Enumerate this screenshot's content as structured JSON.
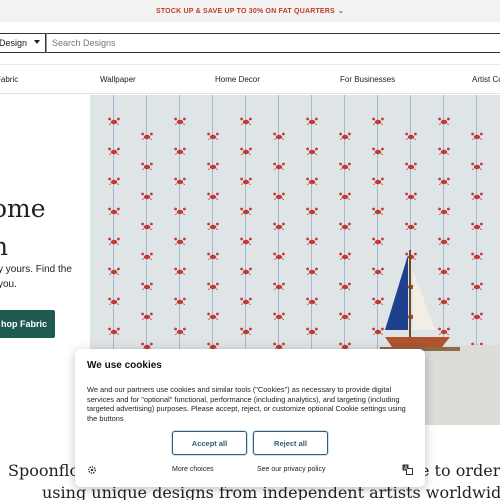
{
  "promo": {
    "text": "STOCK UP & SAVE UP TO 30% ON FAT QUARTERS",
    "chevron": "chevron-down-icon",
    "color": "#c0392b"
  },
  "search": {
    "category": "Design",
    "placeholder": "Search Designs"
  },
  "nav": {
    "items": [
      "Fabric",
      "Wallpaper",
      "Home Decor",
      "For Businesses",
      "Artist Co"
    ]
  },
  "hero": {
    "title": "ome\nh",
    "subtitle": "y yours. Find the\nyou.",
    "button": "hop Fabric",
    "button_color": "#1e5a4f"
  },
  "tagline": {
    "left": "Spoonflow",
    "right": "e to order",
    "second": "using unique designs from independent artists worldwide."
  },
  "cookie": {
    "title": "We use cookies",
    "body": "We and our partners use cookies and similar tools (\"Cookies\") as necessary to provide digital services and for \"optional\" functional, performance (including analytics), and targeting (including targeted advertising) purposes. Please accept, reject, or customize optional Cookie settings using the buttons",
    "accept": "Accept all",
    "reject": "Reject all",
    "more": "More choices",
    "privacy": "See our privacy policy",
    "accent": "#2d5f7a"
  }
}
